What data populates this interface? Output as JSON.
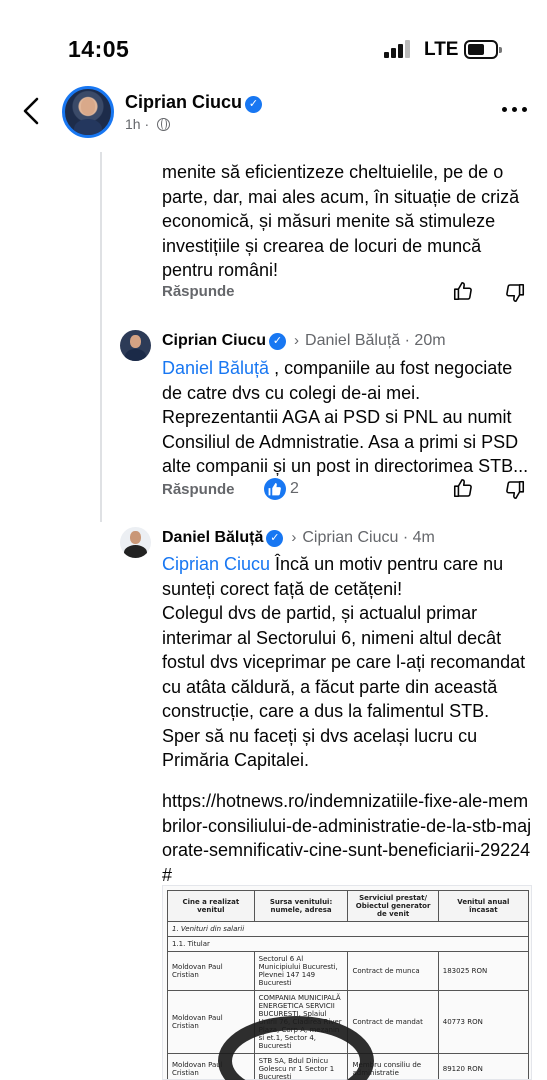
{
  "status_bar": {
    "time": "14:05",
    "network": "LTE"
  },
  "header": {
    "name": "Ciprian Ciucu",
    "time": "1h",
    "separator": "·"
  },
  "comment_1": {
    "text": "menite să eficientizeze cheltuielile, pe de o parte, dar, mai ales acum, în situație de criză economică, și măsuri menite să stimuleze investițiile și crearea de locuri de muncă pentru români!",
    "reply_label": "Răspunde"
  },
  "comment_2": {
    "author": "Ciprian Ciucu",
    "reply_to": "Daniel Băluță",
    "time": "· 20m",
    "mention": "Daniel Băluță",
    "text": " , companiile au fost negociate de catre dvs cu colegi de-ai mei. Reprezentantii AGA ai PSD si PNL au numit Consiliul de Admnistratie. Asa a primi si PSD alte companii și un post in directorimea STB...",
    "reply_label": "Răspunde",
    "reaction_count": "2"
  },
  "comment_3": {
    "author": "Daniel Băluță",
    "reply_to": "Ciprian Ciucu",
    "time": "· 4m",
    "mention": "Ciprian Ciucu",
    "text_line1": " Încă un motiv pentru care nu sunteți corect față de cetățeni!",
    "paragraph": "Colegul dvs de partid, și actualul primar interimar al Sectorului 6, nimeni altul decât fostul dvs viceprimar pe care l-ați recomandat cu atâta căldură, a făcut parte din această construcție, care a dus la falimentul STB. Sper să nu faceți și dvs același lucru cu Primăria Capitalei.",
    "link": "https://hotnews.ro/indemnizatiile-fixe-ale-membrilor-consiliului-de-administratie-de-la-stb-majorate-semnificativ-cine-sunt-beneficiarii-29224#"
  },
  "attached_table": {
    "headers": [
      "Cine a realizat venitul",
      "Sursa venitului: numele, adresa",
      "Serviciul prestat/ Obiectul generator de venit",
      "Venitul anual încasat"
    ],
    "section_1": "1. Venituri din salarii",
    "section_1_1": "1.1. Titular",
    "rows": [
      [
        "Moldovan Paul Cristian",
        "Sectorul 6 Al Municipiului Bucuresti, Plevnei 147 149 Bucuresti",
        "Contract de munca",
        "183025 RON"
      ],
      [
        "Moldovan Paul Cristian",
        "COMPANIA MUNICIPALĂ ENERGETICA SERVICII BUCURESTI, Splaiul Unirii 76, Cladirea River Plaza, Corp A, mezanin si et.1, Sector 4, Bucuresti",
        "Contract de mandat",
        "40773 RON"
      ],
      [
        "Moldovan Paul Cristian",
        "STB SA, Bdul Dinicu Golescu nr 1 Sector 1 Bucuresti",
        "Membru consiliu de administratie",
        "89120 RON"
      ]
    ]
  }
}
